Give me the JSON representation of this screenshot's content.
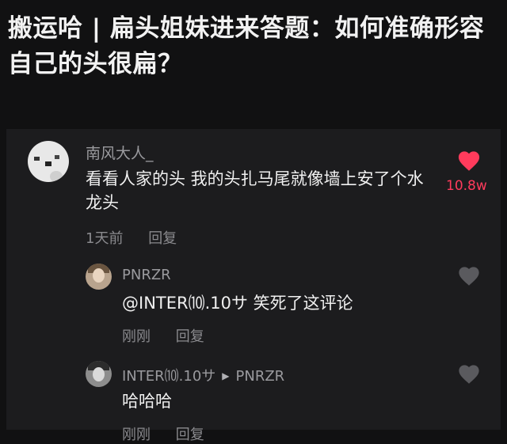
{
  "post": {
    "title": "搬运哈 | 扁头姐妹进来答题：如何准确形容自己的头很扁？"
  },
  "comment": {
    "author": "南风大人_",
    "text": "看看人家的头 我的头扎马尾就像墙上安了个水龙头",
    "time": "1天前",
    "reply_label": "回复",
    "like_count": "10.8w",
    "liked": true,
    "heart_color": "#ff3b5c"
  },
  "replies": [
    {
      "author": "PNRZR",
      "text": "@INTER⑽.10サ 笑死了这评论",
      "time": "刚刚",
      "reply_label": "回复"
    },
    {
      "author": "INTER⑽.10サ",
      "reply_to": "PNRZR",
      "text": "哈哈哈",
      "time": "刚刚",
      "reply_label": "回复"
    }
  ],
  "icons": {
    "like_active": "heart-filled-icon",
    "like_inactive": "heart-outline-icon",
    "reply_arrow": "triangle-right-icon"
  }
}
